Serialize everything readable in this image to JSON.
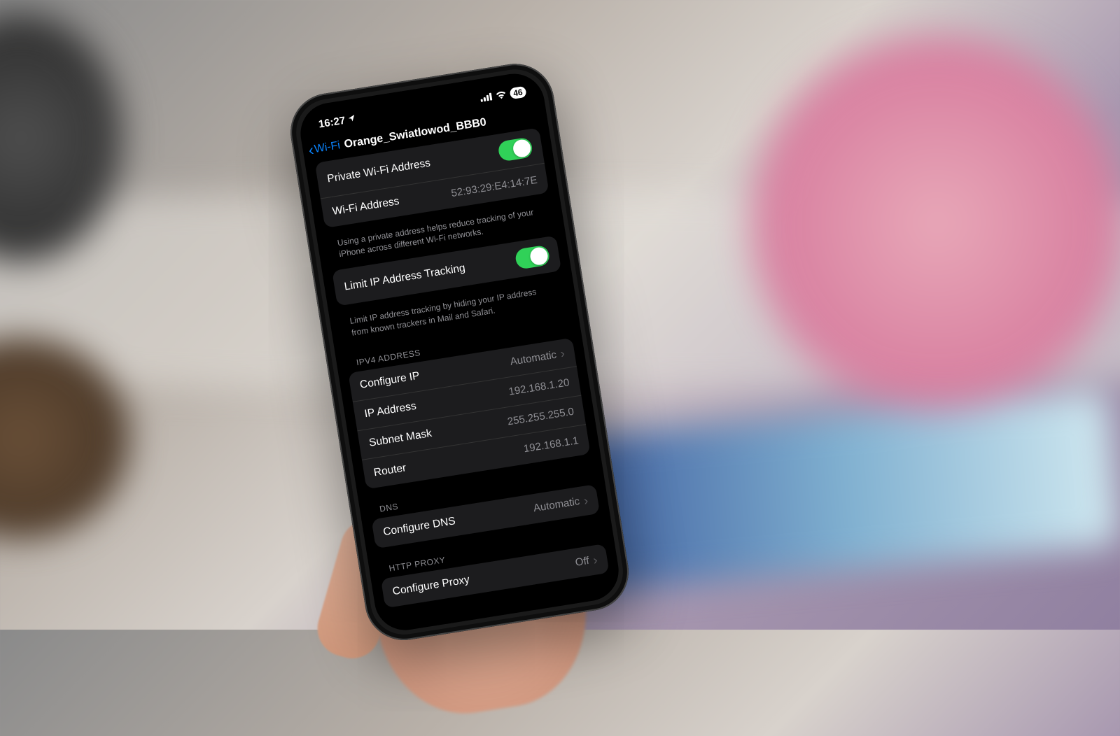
{
  "status": {
    "time": "16:27",
    "battery": "46"
  },
  "nav": {
    "back_label": "Wi-Fi",
    "title": "Orange_Swiatlowod_BBB0"
  },
  "group1": {
    "row1_label": "Private Wi-Fi Address",
    "row2_label": "Wi-Fi Address",
    "row2_value": "52:93:29:E4:14:7E",
    "footer": "Using a private address helps reduce tracking of your iPhone across different Wi-Fi networks."
  },
  "group2": {
    "row1_label": "Limit IP Address Tracking",
    "footer": "Limit IP address tracking by hiding your IP address from known trackers in Mail and Safari."
  },
  "ipv4": {
    "header": "IPV4 ADDRESS",
    "configure_label": "Configure IP",
    "configure_value": "Automatic",
    "ip_label": "IP Address",
    "ip_value": "192.168.1.20",
    "subnet_label": "Subnet Mask",
    "subnet_value": "255.255.255.0",
    "router_label": "Router",
    "router_value": "192.168.1.1"
  },
  "dns": {
    "header": "DNS",
    "configure_label": "Configure DNS",
    "configure_value": "Automatic"
  },
  "proxy": {
    "header": "HTTP PROXY",
    "configure_label": "Configure Proxy",
    "configure_value": "Off"
  }
}
